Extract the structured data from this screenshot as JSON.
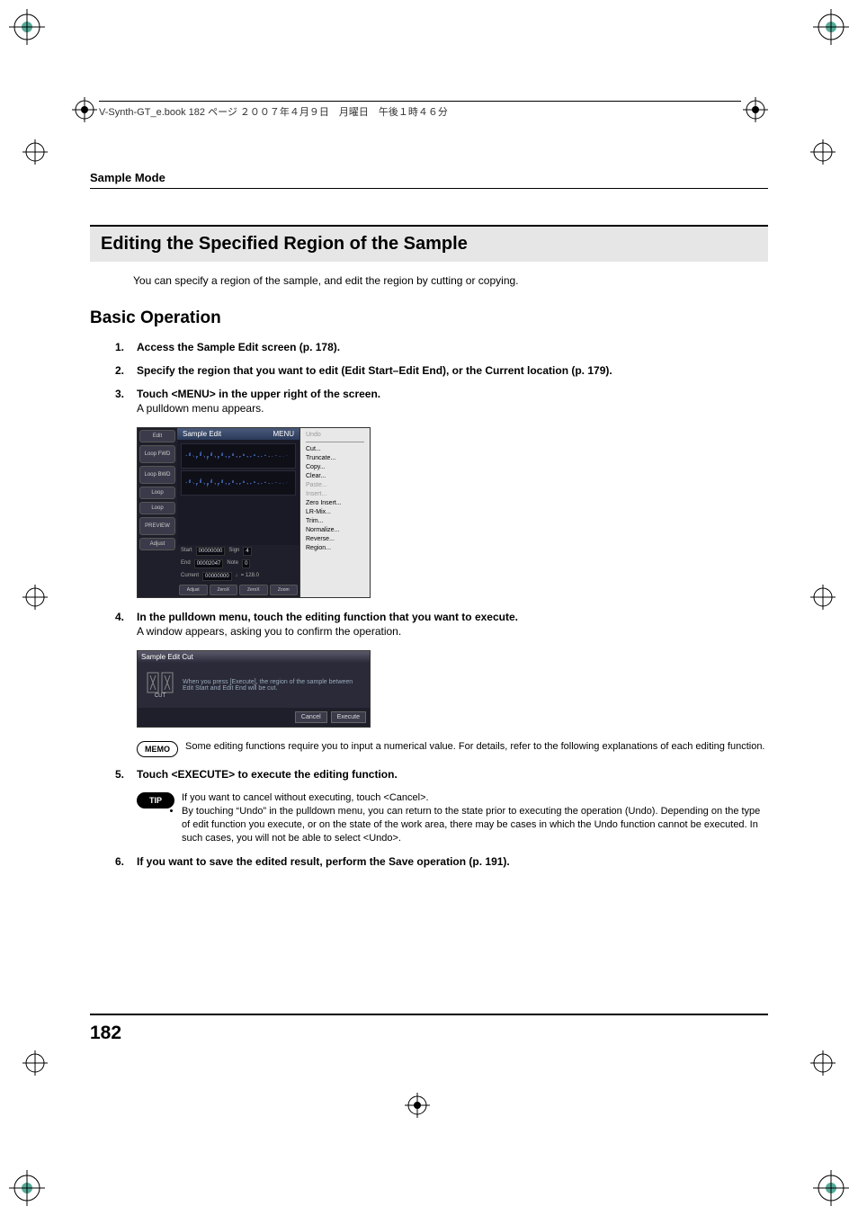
{
  "header": {
    "book_line": "V-Synth-GT_e.book  182 ページ  ２００７年４月９日　月曜日　午後１時４６分"
  },
  "running_head": "Sample Mode",
  "h1": "Editing the Specified Region of the Sample",
  "intro": "You can specify a region of the sample, and edit the region by cutting or copying.",
  "h2": "Basic Operation",
  "steps": {
    "s1": {
      "num": "1.",
      "bold": "Access the Sample Edit screen (p. 178)."
    },
    "s2": {
      "num": "2.",
      "bold": "Specify the region that you want to edit (Edit Start–Edit End), or the Current location (p. 179)."
    },
    "s3": {
      "num": "3.",
      "bold": "Touch <MENU> in the upper right of the screen.",
      "plain": "A pulldown menu appears."
    },
    "s4": {
      "num": "4.",
      "bold": "In the pulldown menu, touch the editing function that you want to execute.",
      "plain": "A window appears, asking you to confirm the operation."
    },
    "s5": {
      "num": "5.",
      "bold": "Touch <EXECUTE> to execute the editing function."
    },
    "s6": {
      "num": "6.",
      "bold": "If you want to save the edited result, perform the Save operation (p. 191)."
    }
  },
  "memo": "Some editing functions require you to input a numerical value. For details, refer to the following explanations of each editing function.",
  "tip": {
    "b1": "If you want to cancel without executing, touch <Cancel>.",
    "b2": "By touching “Undo” in the pulldown menu, you can return to the state prior to executing the operation (Undo). Depending on the type of edit function you execute, or on the state of the work area, there may be cases in which the Undo function cannot be executed. In such cases, you will not be able to select <Undo>."
  },
  "badge": {
    "memo": "MEMO",
    "tip": "TIP"
  },
  "page_number": "182",
  "fig1": {
    "title": "Sample Edit",
    "menu_btn": "MENU",
    "left_buttons": [
      "Edit",
      "Loop FWD",
      "Loop BWD",
      "Loop",
      "Loop",
      "PREVIEW",
      "Adjust"
    ],
    "params": {
      "start_lbl": "Start",
      "start_val": "00000000",
      "end_lbl": "End",
      "end_val": "00002047",
      "cur_lbl": "Current",
      "cur_val": "00000000",
      "sign_lbl": "Sign",
      "sign_val": "4",
      "note_lbl": "Note",
      "note_val": "0",
      "tempo": "♩= 128.0"
    },
    "bottom": [
      "Adjust",
      "ZeroX",
      "ZeroX",
      "Zoom"
    ],
    "menu_items": [
      "Undo",
      "Cut...",
      "Truncate...",
      "Copy...",
      "Clear...",
      "Paste...",
      "Insert...",
      "Zero Insert...",
      "LR-Mix...",
      "Trim...",
      "Normalize...",
      "Reverse...",
      "Region..."
    ]
  },
  "fig2": {
    "title": "Sample Edit Cut",
    "msg": "When you press [Execute], the region of the sample between Edit Start and Edit End will be cut.",
    "icon_label": "CUT",
    "cancel": "Cancel",
    "execute": "Execute"
  }
}
